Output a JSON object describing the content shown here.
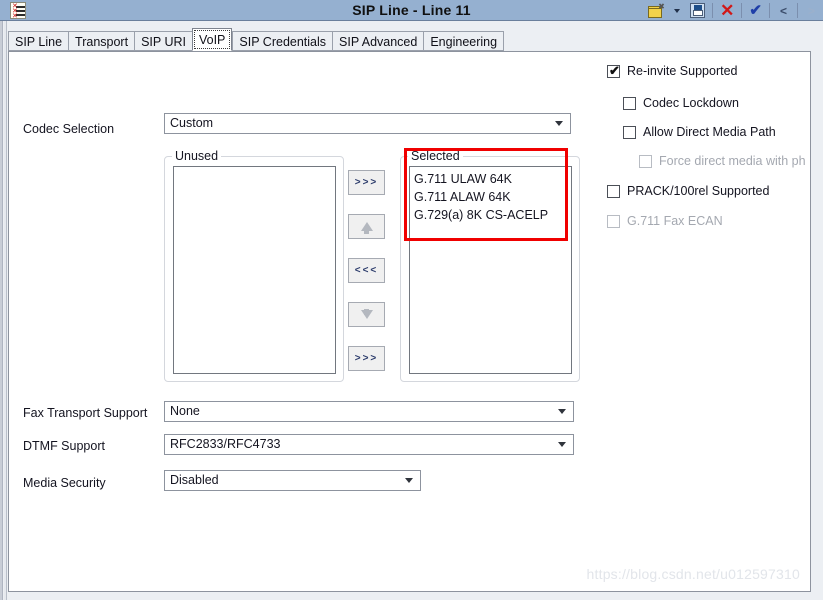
{
  "window": {
    "title": "SIP Line - Line 11",
    "app_icon": "list-document-icon",
    "toolbar": [
      {
        "name": "open-icon",
        "label": ""
      },
      {
        "name": "open-dropdown-caret-icon",
        "label": ""
      },
      {
        "name": "save-icon",
        "label": ""
      },
      {
        "name": "cancel-icon",
        "label": "✕"
      },
      {
        "name": "ok-icon",
        "label": "✔"
      },
      {
        "name": "previous-icon",
        "label": "<"
      },
      {
        "name": "next-icon",
        "label": ">"
      }
    ]
  },
  "tabs": [
    {
      "label": "SIP Line",
      "active": false
    },
    {
      "label": "Transport",
      "active": false
    },
    {
      "label": "SIP URI",
      "active": false
    },
    {
      "label": "VoIP",
      "active": true
    },
    {
      "label": "SIP Credentials",
      "active": false
    },
    {
      "label": "SIP Advanced",
      "active": false
    },
    {
      "label": "Engineering",
      "active": false
    }
  ],
  "form": {
    "codec_selection": {
      "label": "Codec Selection",
      "value": "Custom"
    },
    "unused": {
      "caption": "Unused",
      "items": []
    },
    "selected": {
      "caption": "Selected",
      "items": [
        "G.711 ULAW 64K",
        "G.711 ALAW 64K",
        "G.729(a) 8K CS-ACELP"
      ]
    },
    "transfer_buttons": [
      {
        "name": "add-all-button",
        "label": ">>>"
      },
      {
        "name": "move-up-button",
        "label": ""
      },
      {
        "name": "remove-button",
        "label": "<<<"
      },
      {
        "name": "move-down-button",
        "label": ""
      },
      {
        "name": "add-button",
        "label": ">>>"
      }
    ],
    "fax_transport_support": {
      "label": "Fax Transport Support",
      "value": "None"
    },
    "dtmf_support": {
      "label": "DTMF Support",
      "value": "RFC2833/RFC4733"
    },
    "media_security": {
      "label": "Media Security",
      "value": "Disabled"
    }
  },
  "options": [
    {
      "label": "Re-invite Supported",
      "checked": true,
      "enabled": true,
      "indent": 0
    },
    {
      "label": "Codec Lockdown",
      "checked": false,
      "enabled": true,
      "indent": 1
    },
    {
      "label": "Allow Direct Media Path",
      "checked": false,
      "enabled": true,
      "indent": 1
    },
    {
      "label": "Force direct media with ph",
      "checked": false,
      "enabled": false,
      "indent": 2
    },
    {
      "label": "PRACK/100rel Supported",
      "checked": false,
      "enabled": true,
      "indent": 0
    },
    {
      "label": "G.711 Fax ECAN",
      "checked": false,
      "enabled": false,
      "indent": 0
    }
  ],
  "watermark": "https://blog.csdn.net/u012597310",
  "colors": {
    "titlebar": "#95b0d0",
    "annotation": "#f00000",
    "panel": "#ffffff"
  }
}
